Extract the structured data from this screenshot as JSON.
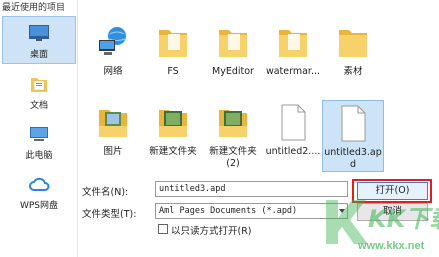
{
  "sidebar": {
    "header": "最近使用的项目",
    "items": [
      {
        "label": "桌面",
        "icon": "desktop-icon",
        "selected": true
      },
      {
        "label": "文档",
        "icon": "documents-icon",
        "selected": false
      },
      {
        "label": "此电脑",
        "icon": "computer-icon",
        "selected": false
      },
      {
        "label": "WPS网盘",
        "icon": "cloud-icon",
        "selected": false
      }
    ]
  },
  "files": [
    {
      "label": "网络",
      "icon": "network-icon"
    },
    {
      "label": "FS",
      "icon": "folder-icon"
    },
    {
      "label": "MyEditor",
      "icon": "folder-icon"
    },
    {
      "label": "watermar...",
      "icon": "folder-icon"
    },
    {
      "label": "素材",
      "icon": "folder-icon"
    },
    {
      "label": "图片",
      "icon": "picture-folder-icon"
    },
    {
      "label": "新建文件夹",
      "icon": "picture-folder-icon"
    },
    {
      "label": "新建文件夹",
      "label2": "(2)",
      "icon": "picture-folder-icon"
    },
    {
      "label": "untitled2....",
      "icon": "file-icon"
    },
    {
      "label": "untitled3.ap",
      "label2": "d",
      "icon": "file-icon",
      "selected": true
    }
  ],
  "bottom": {
    "filename_label": "文件名(N):",
    "filename_value": "untitled3.apd",
    "filetype_label": "文件类型(T):",
    "filetype_value": "Aml Pages Documents (*.apd)",
    "readonly_label": "以只读方式打开(R)",
    "open_button": "打开(O)",
    "cancel_button": "取消"
  },
  "watermark": {
    "big": "KK下载",
    "url": "www.kkx.net"
  },
  "colors": {
    "selection": "#cfe3f7",
    "highlight": "#e02020",
    "folder": "#f3c54e",
    "watermark": "#3cb450"
  }
}
